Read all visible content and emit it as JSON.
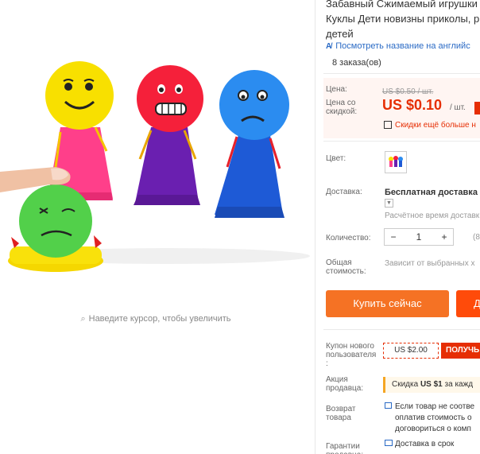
{
  "product": {
    "title_lines": [
      "Забавный Сжимаемый игрушки",
      "Куклы Дети новизны приколы, р",
      "детей"
    ],
    "translate_link": "Посмотреть название на английс",
    "orders": "8 заказа(ов)"
  },
  "gallery": {
    "zoom_hint": "Наведите курсор, чтобы увеличить"
  },
  "price": {
    "label_price": "Цена:",
    "old_value": "US $0.50 / шт.",
    "label_discount": "Цена со скидкой:",
    "new_value": "US $0.10",
    "unit": "/ шт.",
    "qr_text": "Скидки ещё больше н"
  },
  "options": {
    "color_label": "Цвет:",
    "shipping_label": "Доставка:",
    "shipping_value": "Бесплатная доставка в",
    "shipping_time": "Расчётное время доставк",
    "quantity_label": "Количество:",
    "quantity_value": "1",
    "quantity_minus": "−",
    "quantity_plus": "+",
    "quantity_extra": "(8",
    "total_label": "Общая стоимость:",
    "total_value": "Зависит от выбранных х"
  },
  "actions": {
    "buy_now": "Купить сейчас",
    "add_to_cart": "Д"
  },
  "coupons": {
    "new_user_label": "Купон нового пользователя :",
    "new_user_value": "US $2.00",
    "get_button": "ПОЛУЧЬ",
    "seller_promo_label": "Акция продавца:",
    "seller_promo_value_pre": "Скидка ",
    "seller_promo_value_bold": "US $1",
    "seller_promo_value_post": " за кажд",
    "return_label": "Возврат товара",
    "return_lines": [
      "Если товар не соотве",
      "оплатив стоимость о",
      "договориться о комп"
    ],
    "guarantee_label": "Гарантии продавца:",
    "guarantee_value": "Доставка в срок"
  },
  "colors": {
    "accent": "#e62e04",
    "buy": "#f57224",
    "link": "#2a6ac5"
  }
}
